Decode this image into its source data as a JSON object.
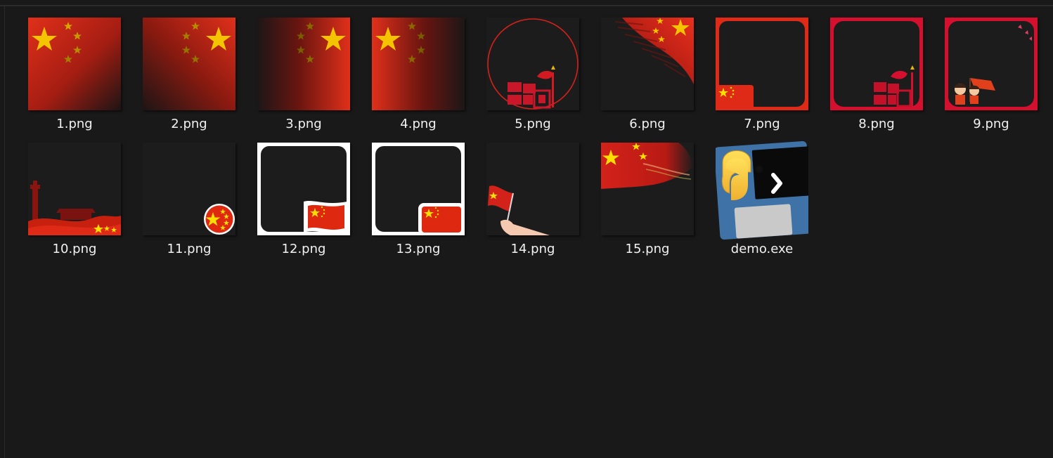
{
  "files": [
    {
      "name": "1.png",
      "icon": "flag-left-stars-thumbnail"
    },
    {
      "name": "2.png",
      "icon": "flag-right-stars-thumbnail"
    },
    {
      "name": "3.png",
      "icon": "flag-fade-left-thumbnail"
    },
    {
      "name": "4.png",
      "icon": "flag-fade-right-thumbnail"
    },
    {
      "name": "5.png",
      "icon": "circle-frame-thumbnail"
    },
    {
      "name": "6.png",
      "icon": "brush-flag-corner-thumbnail"
    },
    {
      "name": "7.png",
      "icon": "red-frame-flag-thumbnail"
    },
    {
      "name": "8.png",
      "icon": "red-frame-calligraphy-thumbnail"
    },
    {
      "name": "9.png",
      "icon": "red-frame-kids-thumbnail"
    },
    {
      "name": "10.png",
      "icon": "tiananmen-banner-thumbnail"
    },
    {
      "name": "11.png",
      "icon": "flag-badge-thumbnail"
    },
    {
      "name": "12.png",
      "icon": "white-frame-waving-flag-thumbnail"
    },
    {
      "name": "13.png",
      "icon": "white-frame-flag-thumbnail"
    },
    {
      "name": "14.png",
      "icon": "hand-flag-thumbnail"
    },
    {
      "name": "15.png",
      "icon": "silk-flag-thumbnail"
    },
    {
      "name": "demo.exe",
      "icon": "python-executable-icon"
    }
  ],
  "colors": {
    "background": "#191919",
    "flag_red": "#de2910",
    "star_yellow": "#ffde00",
    "frame_crimson": "#d5102f",
    "label_text": "#f2f2f2"
  }
}
